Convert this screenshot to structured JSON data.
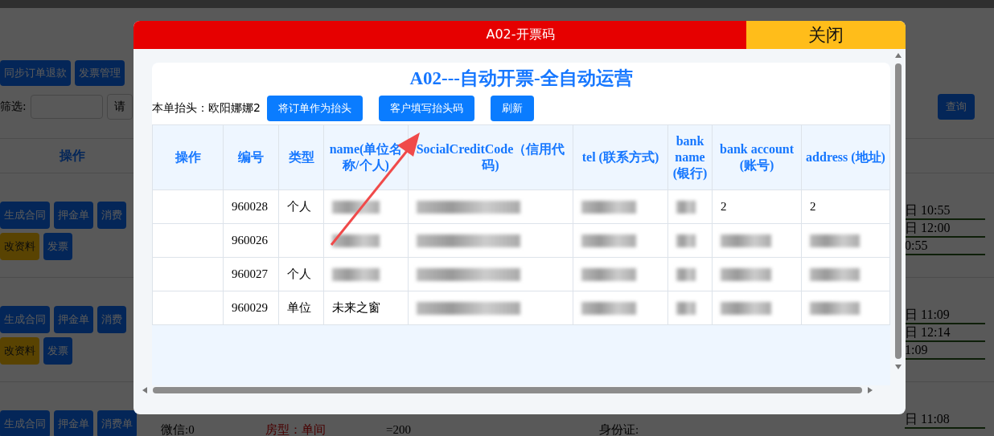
{
  "background": {
    "toolbar_buttons": [
      "同步订单退款",
      "发票管理"
    ],
    "filter_label": "筛选:",
    "select_text": "请",
    "query_button": "查询",
    "column_header": "操作",
    "rows": [
      {
        "buttons": [
          {
            "label": "生成合同",
            "kind": "primary"
          },
          {
            "label": "押金单",
            "kind": "primary"
          },
          {
            "label": "消费",
            "kind": "primary"
          },
          {
            "label": "改资料",
            "kind": "warning"
          },
          {
            "label": "发票",
            "kind": "primary"
          }
        ],
        "times": [
          "日 10:55",
          "日 12:00",
          "0:55"
        ],
        "details": []
      },
      {
        "buttons": [
          {
            "label": "生成合同",
            "kind": "primary"
          },
          {
            "label": "押金单",
            "kind": "primary"
          },
          {
            "label": "消费",
            "kind": "primary"
          },
          {
            "label": "改资料",
            "kind": "warning"
          },
          {
            "label": "发票",
            "kind": "primary"
          }
        ],
        "times": [
          "日 11:09",
          "日 12:14",
          "1:09"
        ],
        "details": []
      },
      {
        "buttons": [
          {
            "label": "生成合同",
            "kind": "primary"
          },
          {
            "label": "押金单",
            "kind": "primary"
          },
          {
            "label": "消费单",
            "kind": "primary"
          }
        ],
        "times": [
          "日 11:08"
        ],
        "details": [
          {
            "lines": [
              "微信:0"
            ],
            "kind": "plain"
          },
          {
            "lines": [
              "房型：单间"
            ],
            "kind": "room"
          },
          {
            "lines": [
              "=200"
            ],
            "kind": "plain"
          },
          {
            "lines": [
              "身份证:"
            ],
            "kind": "plain"
          }
        ]
      }
    ]
  },
  "modal": {
    "title": "A02-开票码",
    "close": "关闭",
    "heading": "A02---自动开票-全自动运营",
    "header_label": "本单抬头：欧阳娜娜2",
    "buttons": [
      "将订单作为抬头",
      "客户填写抬头码",
      "刷新"
    ],
    "table": {
      "columns": [
        "操作",
        "编号",
        "类型",
        "name(单位名称/个人)",
        "SocialCreditCode（信用代码)",
        "tel (联系方式)",
        "bank name (银行)",
        "bank account (账号)",
        "address (地址)"
      ],
      "rows": [
        {
          "cells": [
            {
              "blurred": false
            },
            {
              "text": "960028",
              "blurred": false
            },
            {
              "text": "个人",
              "blurred": false
            },
            {
              "blurred": true
            },
            {
              "blurred": true
            },
            {
              "blurred": true
            },
            {
              "blurred": true
            },
            {
              "text": "2",
              "blurred": false
            },
            {
              "text": "2",
              "blurred": false
            }
          ]
        },
        {
          "cells": [
            {
              "blurred": false
            },
            {
              "text": "960026",
              "blurred": false
            },
            {
              "blurred": false
            },
            {
              "blurred": true
            },
            {
              "blurred": true
            },
            {
              "blurred": true
            },
            {
              "blurred": true
            },
            {
              "blurred": true
            },
            {
              "blurred": true
            }
          ]
        },
        {
          "cells": [
            {
              "blurred": false
            },
            {
              "text": "960027",
              "blurred": false
            },
            {
              "text": "个人",
              "blurred": false
            },
            {
              "blurred": true
            },
            {
              "blurred": true
            },
            {
              "blurred": true
            },
            {
              "blurred": true
            },
            {
              "blurred": true
            },
            {
              "blurred": true
            }
          ]
        },
        {
          "cells": [
            {
              "blurred": false
            },
            {
              "text": "960029",
              "blurred": false
            },
            {
              "text": "单位",
              "blurred": false
            },
            {
              "text": "未来之窗",
              "blurred": false
            },
            {
              "blurred": true
            },
            {
              "blurred": true
            },
            {
              "blurred": true
            },
            {
              "blurred": true
            },
            {
              "blurred": true
            }
          ]
        }
      ]
    }
  }
}
